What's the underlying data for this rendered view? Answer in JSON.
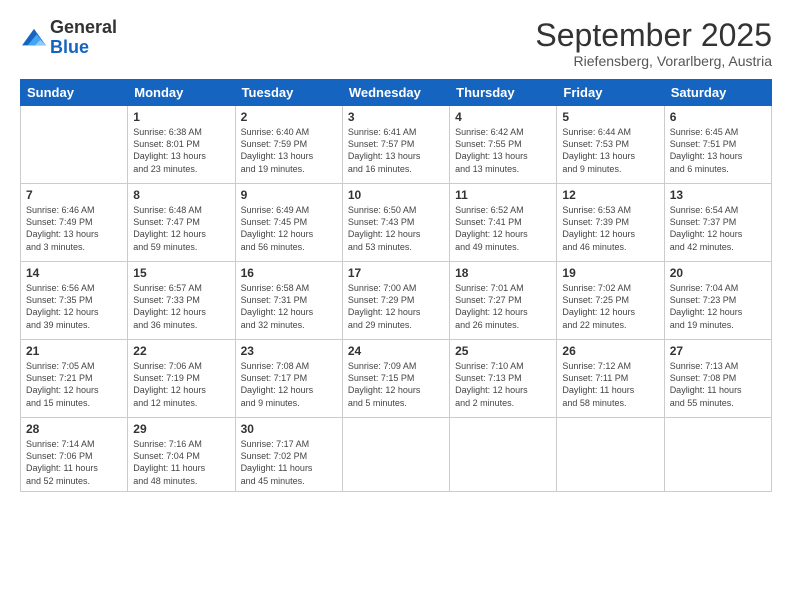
{
  "logo": {
    "general": "General",
    "blue": "Blue"
  },
  "title": "September 2025",
  "location": "Riefensberg, Vorarlberg, Austria",
  "days_header": [
    "Sunday",
    "Monday",
    "Tuesday",
    "Wednesday",
    "Thursday",
    "Friday",
    "Saturday"
  ],
  "weeks": [
    [
      {
        "day": "",
        "info": ""
      },
      {
        "day": "1",
        "info": "Sunrise: 6:38 AM\nSunset: 8:01 PM\nDaylight: 13 hours\nand 23 minutes."
      },
      {
        "day": "2",
        "info": "Sunrise: 6:40 AM\nSunset: 7:59 PM\nDaylight: 13 hours\nand 19 minutes."
      },
      {
        "day": "3",
        "info": "Sunrise: 6:41 AM\nSunset: 7:57 PM\nDaylight: 13 hours\nand 16 minutes."
      },
      {
        "day": "4",
        "info": "Sunrise: 6:42 AM\nSunset: 7:55 PM\nDaylight: 13 hours\nand 13 minutes."
      },
      {
        "day": "5",
        "info": "Sunrise: 6:44 AM\nSunset: 7:53 PM\nDaylight: 13 hours\nand 9 minutes."
      },
      {
        "day": "6",
        "info": "Sunrise: 6:45 AM\nSunset: 7:51 PM\nDaylight: 13 hours\nand 6 minutes."
      }
    ],
    [
      {
        "day": "7",
        "info": "Sunrise: 6:46 AM\nSunset: 7:49 PM\nDaylight: 13 hours\nand 3 minutes."
      },
      {
        "day": "8",
        "info": "Sunrise: 6:48 AM\nSunset: 7:47 PM\nDaylight: 12 hours\nand 59 minutes."
      },
      {
        "day": "9",
        "info": "Sunrise: 6:49 AM\nSunset: 7:45 PM\nDaylight: 12 hours\nand 56 minutes."
      },
      {
        "day": "10",
        "info": "Sunrise: 6:50 AM\nSunset: 7:43 PM\nDaylight: 12 hours\nand 53 minutes."
      },
      {
        "day": "11",
        "info": "Sunrise: 6:52 AM\nSunset: 7:41 PM\nDaylight: 12 hours\nand 49 minutes."
      },
      {
        "day": "12",
        "info": "Sunrise: 6:53 AM\nSunset: 7:39 PM\nDaylight: 12 hours\nand 46 minutes."
      },
      {
        "day": "13",
        "info": "Sunrise: 6:54 AM\nSunset: 7:37 PM\nDaylight: 12 hours\nand 42 minutes."
      }
    ],
    [
      {
        "day": "14",
        "info": "Sunrise: 6:56 AM\nSunset: 7:35 PM\nDaylight: 12 hours\nand 39 minutes."
      },
      {
        "day": "15",
        "info": "Sunrise: 6:57 AM\nSunset: 7:33 PM\nDaylight: 12 hours\nand 36 minutes."
      },
      {
        "day": "16",
        "info": "Sunrise: 6:58 AM\nSunset: 7:31 PM\nDaylight: 12 hours\nand 32 minutes."
      },
      {
        "day": "17",
        "info": "Sunrise: 7:00 AM\nSunset: 7:29 PM\nDaylight: 12 hours\nand 29 minutes."
      },
      {
        "day": "18",
        "info": "Sunrise: 7:01 AM\nSunset: 7:27 PM\nDaylight: 12 hours\nand 26 minutes."
      },
      {
        "day": "19",
        "info": "Sunrise: 7:02 AM\nSunset: 7:25 PM\nDaylight: 12 hours\nand 22 minutes."
      },
      {
        "day": "20",
        "info": "Sunrise: 7:04 AM\nSunset: 7:23 PM\nDaylight: 12 hours\nand 19 minutes."
      }
    ],
    [
      {
        "day": "21",
        "info": "Sunrise: 7:05 AM\nSunset: 7:21 PM\nDaylight: 12 hours\nand 15 minutes."
      },
      {
        "day": "22",
        "info": "Sunrise: 7:06 AM\nSunset: 7:19 PM\nDaylight: 12 hours\nand 12 minutes."
      },
      {
        "day": "23",
        "info": "Sunrise: 7:08 AM\nSunset: 7:17 PM\nDaylight: 12 hours\nand 9 minutes."
      },
      {
        "day": "24",
        "info": "Sunrise: 7:09 AM\nSunset: 7:15 PM\nDaylight: 12 hours\nand 5 minutes."
      },
      {
        "day": "25",
        "info": "Sunrise: 7:10 AM\nSunset: 7:13 PM\nDaylight: 12 hours\nand 2 minutes."
      },
      {
        "day": "26",
        "info": "Sunrise: 7:12 AM\nSunset: 7:11 PM\nDaylight: 11 hours\nand 58 minutes."
      },
      {
        "day": "27",
        "info": "Sunrise: 7:13 AM\nSunset: 7:08 PM\nDaylight: 11 hours\nand 55 minutes."
      }
    ],
    [
      {
        "day": "28",
        "info": "Sunrise: 7:14 AM\nSunset: 7:06 PM\nDaylight: 11 hours\nand 52 minutes."
      },
      {
        "day": "29",
        "info": "Sunrise: 7:16 AM\nSunset: 7:04 PM\nDaylight: 11 hours\nand 48 minutes."
      },
      {
        "day": "30",
        "info": "Sunrise: 7:17 AM\nSunset: 7:02 PM\nDaylight: 11 hours\nand 45 minutes."
      },
      {
        "day": "",
        "info": ""
      },
      {
        "day": "",
        "info": ""
      },
      {
        "day": "",
        "info": ""
      },
      {
        "day": "",
        "info": ""
      }
    ]
  ]
}
